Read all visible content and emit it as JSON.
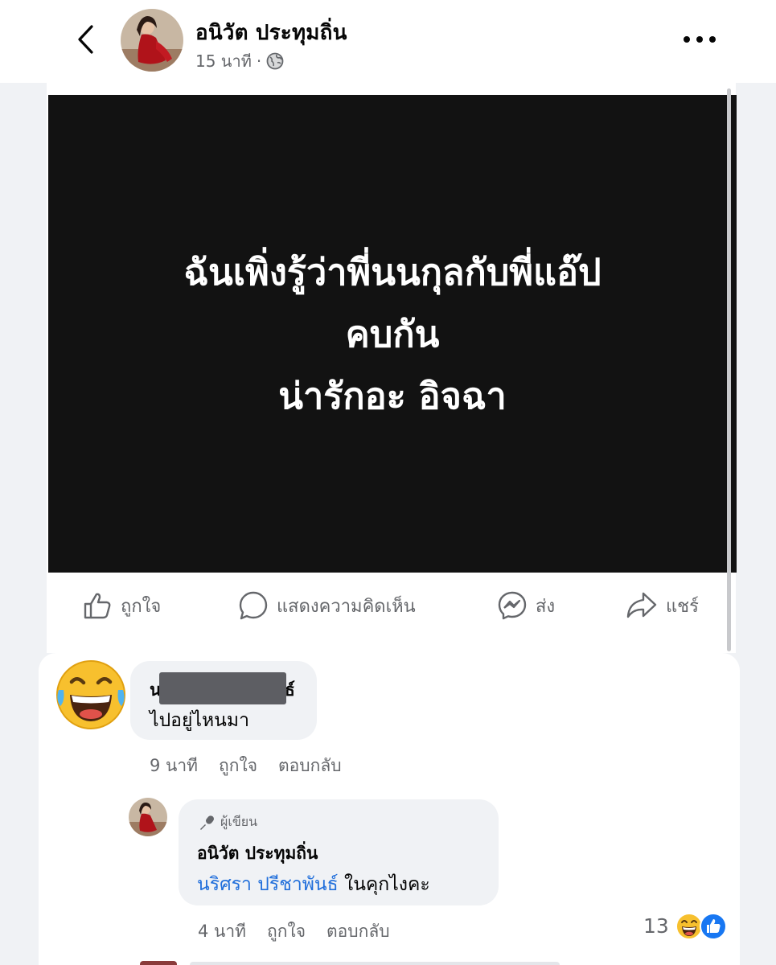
{
  "header": {
    "author_name": "อนิวัต ประทุมถิ่น",
    "time": "15 นาที",
    "separator": "·",
    "icons": {
      "back": "chevron-left-icon",
      "privacy": "globe-icon",
      "more": "more-horizontal-icon"
    }
  },
  "post": {
    "lines": [
      "ฉันเพิ่งรู้ว่าพี่นนกุลกับพี่แอ๊ป",
      "คบกัน",
      "น่ารักอะ อิจฉา"
    ],
    "background_color": "#121212",
    "text_color": "#ffffff"
  },
  "actions": {
    "like": "ถูกใจ",
    "comment": "แสดงความคิดเห็น",
    "send": "ส่ง",
    "share": "แชร์",
    "icons": [
      "thumbs-up-icon",
      "comment-icon",
      "messenger-icon",
      "share-icon"
    ]
  },
  "comments": [
    {
      "name_start": "น",
      "name_end": "ธ์",
      "name_redacted": true,
      "text": "ไปอยู่ไหนมา",
      "time": "9 นาที",
      "like": "ถูกใจ",
      "reply": "ตอบกลับ",
      "avatar": "laughing-emoji-icon"
    },
    {
      "author_badge": "ผู้เขียน",
      "name": "อนิวัต ประทุมถิ่น",
      "mention": "นริศรา ปรีชาพันธ์",
      "text": " ในคุกไงคะ",
      "time": "4 นาที",
      "like": "ถูกใจ",
      "reply": "ตอบกลับ",
      "reaction_count": "13",
      "reaction_icons": [
        "haha-reaction-icon",
        "like-reaction-icon"
      ]
    }
  ],
  "colors": {
    "accent_blue": "#216fdb",
    "like_blue": "#1877f2",
    "muted_text": "#65676b",
    "bubble_bg": "#f0f2f5"
  }
}
